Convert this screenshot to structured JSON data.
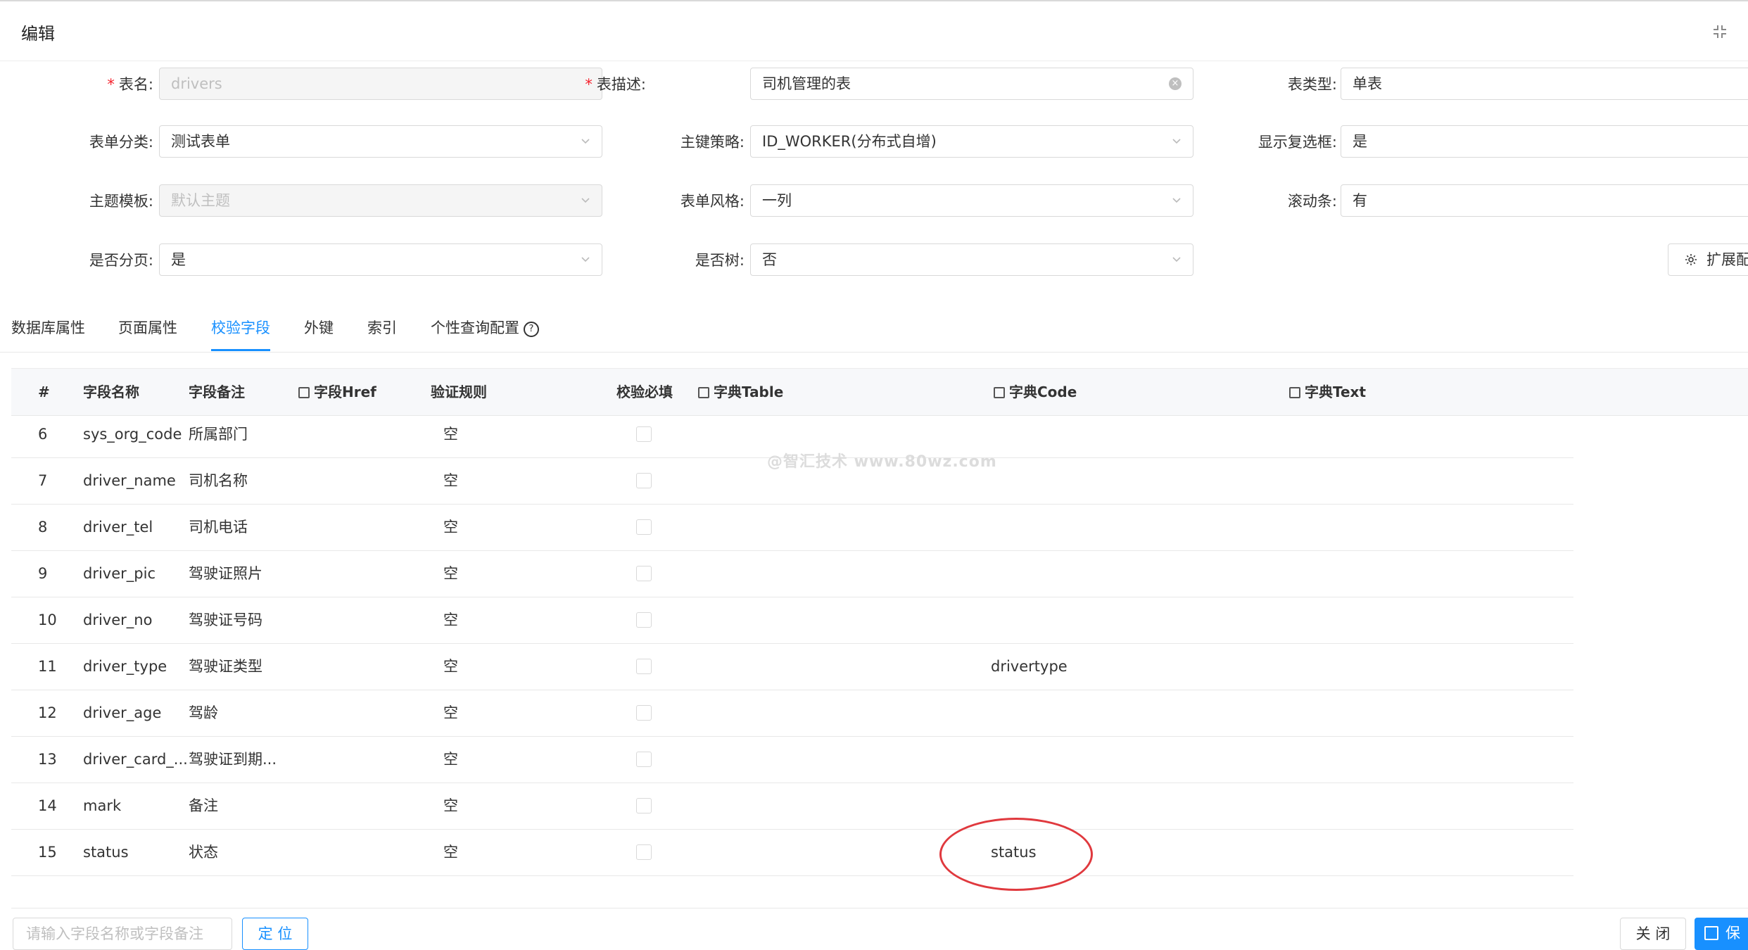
{
  "dialog": {
    "title": "编辑"
  },
  "form": {
    "table_name": {
      "label": "表名:",
      "value": "drivers",
      "required": true
    },
    "table_desc": {
      "label": "表描述:",
      "value": "司机管理的表",
      "required": true
    },
    "table_type": {
      "label": "表类型:",
      "value": "单表"
    },
    "form_category": {
      "label": "表单分类:",
      "value": "测试表单"
    },
    "pk_strategy": {
      "label": "主键策略:",
      "value": "ID_WORKER(分布式自增)"
    },
    "show_checkbox": {
      "label": "显示复选框:",
      "value": "是"
    },
    "theme_template": {
      "label": "主题模板:",
      "value": "默认主题"
    },
    "form_style": {
      "label": "表单风格:",
      "value": "一列"
    },
    "scrollbar": {
      "label": "滚动条:",
      "value": "有"
    },
    "paging": {
      "label": "是否分页:",
      "value": "是"
    },
    "is_tree": {
      "label": "是否树:",
      "value": "否"
    },
    "extend_button": "扩展配"
  },
  "tabs": [
    {
      "label": "数据库属性"
    },
    {
      "label": "页面属性"
    },
    {
      "label": "校验字段",
      "active": true
    },
    {
      "label": "外键"
    },
    {
      "label": "索引"
    },
    {
      "label": "个性查询配置"
    }
  ],
  "table": {
    "headers": {
      "index": "#",
      "field_name": "字段名称",
      "field_remark": "字段备注",
      "field_href": "字段Href",
      "validate_rule": "验证规则",
      "required": "校验必填",
      "dict_table": "字典Table",
      "dict_code": "字典Code",
      "dict_text": "字典Text"
    },
    "rows": [
      {
        "index": "6",
        "name": "sys_org_code",
        "remark": "所属部门",
        "rule": "空",
        "dict_code": ""
      },
      {
        "index": "7",
        "name": "driver_name",
        "remark": "司机名称",
        "rule": "空",
        "dict_code": ""
      },
      {
        "index": "8",
        "name": "driver_tel",
        "remark": "司机电话",
        "rule": "空",
        "dict_code": ""
      },
      {
        "index": "9",
        "name": "driver_pic",
        "remark": "驾驶证照片",
        "rule": "空",
        "dict_code": ""
      },
      {
        "index": "10",
        "name": "driver_no",
        "remark": "驾驶证号码",
        "rule": "空",
        "dict_code": ""
      },
      {
        "index": "11",
        "name": "driver_type",
        "remark": "驾驶证类型",
        "rule": "空",
        "dict_code": "drivertype"
      },
      {
        "index": "12",
        "name": "driver_age",
        "remark": "驾龄",
        "rule": "空",
        "dict_code": ""
      },
      {
        "index": "13",
        "name": "driver_card_...",
        "remark": "驾驶证到期...",
        "rule": "空",
        "dict_code": ""
      },
      {
        "index": "14",
        "name": "mark",
        "remark": "备注",
        "rule": "空",
        "dict_code": ""
      },
      {
        "index": "15",
        "name": "status",
        "remark": "状态",
        "rule": "空",
        "dict_code": "status"
      }
    ]
  },
  "watermark": "@智汇技术 www.80wz.com",
  "footer": {
    "search_placeholder": "请输入字段名称或字段备注",
    "locate_label": "定 位",
    "close_label": "关 闭",
    "save_label": "保"
  },
  "colors": {
    "accent": "#1890ff",
    "required": "#f5222d",
    "annotation": "#e0393e"
  }
}
